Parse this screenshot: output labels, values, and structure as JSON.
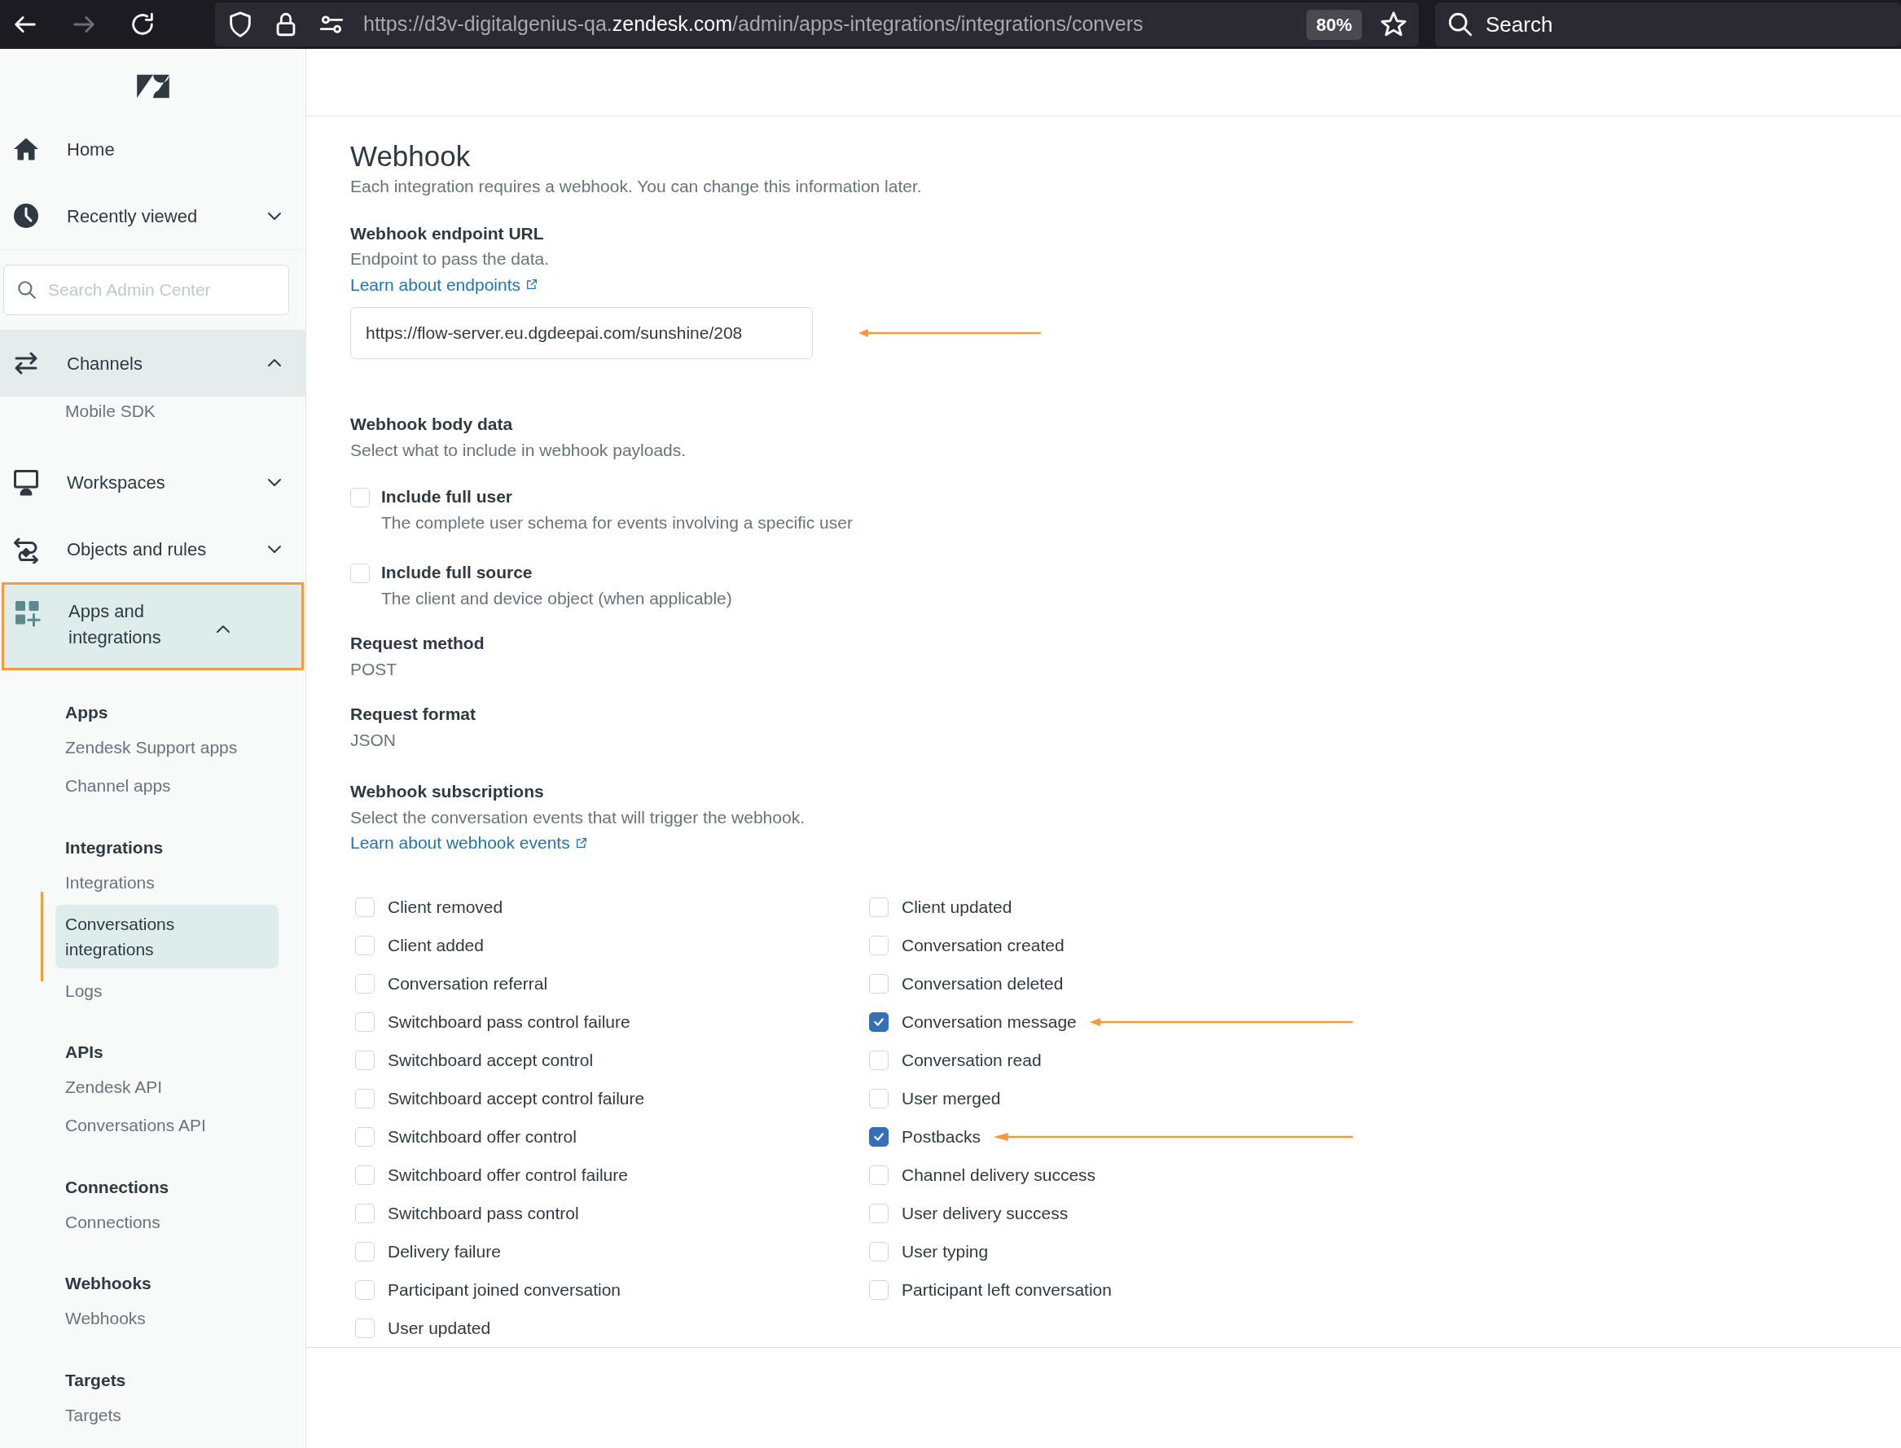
{
  "browser": {
    "url": "https://d3v-digitalgenius-qa.**zendesk.com**/admin/apps-integrations/integrations/convers",
    "zoom": "80%",
    "search_placeholder": "Search"
  },
  "sidebar": {
    "top_items": [
      {
        "label": "Home"
      },
      {
        "label": "Recently viewed",
        "expanded": false
      }
    ],
    "search": {
      "placeholder": "Search Admin Center"
    },
    "sections": [
      {
        "label": "Channels",
        "expanded": true,
        "hovered": true,
        "highlighted": false,
        "groups": [
          {
            "items": [
              {
                "label": "Mobile SDK",
                "selected": false
              }
            ]
          }
        ]
      },
      {
        "label": "Workspaces",
        "expanded": false,
        "hovered": false,
        "highlighted": false
      },
      {
        "label": "Objects and rules",
        "expanded": false,
        "hovered": false,
        "highlighted": false
      },
      {
        "label": "Apps and integrations",
        "expanded": true,
        "hovered": false,
        "highlighted": true,
        "groups": [
          {
            "heading": "Apps",
            "items": [
              {
                "label": "Zendesk Support apps",
                "selected": false
              },
              {
                "label": "Channel apps",
                "selected": false
              }
            ]
          },
          {
            "heading": "Integrations",
            "items": [
              {
                "label": "Integrations",
                "selected": false
              },
              {
                "label": "Conversations integrations",
                "selected": true
              },
              {
                "label": "Logs",
                "selected": false
              }
            ]
          },
          {
            "heading": "APIs",
            "items": [
              {
                "label": "Zendesk API",
                "selected": false
              },
              {
                "label": "Conversations API",
                "selected": false
              }
            ]
          },
          {
            "heading": "Connections",
            "items": [
              {
                "label": "Connections",
                "selected": false
              }
            ]
          },
          {
            "heading": "Webhooks",
            "items": [
              {
                "label": "Webhooks",
                "selected": false
              }
            ]
          },
          {
            "heading": "Targets",
            "items": [
              {
                "label": "Targets",
                "selected": false
              }
            ]
          }
        ]
      }
    ]
  },
  "main": {
    "title": "Webhook",
    "description": "Each integration requires a webhook. You can change this information later.",
    "endpoint": {
      "label": "Webhook endpoint URL",
      "hint": "Endpoint to pass the data.",
      "link": "Learn about endpoints",
      "value": "https://flow-server.eu.dgdeepai.com/sunshine/208",
      "annotated": true
    },
    "body_data": {
      "label": "Webhook body data",
      "hint": "Select what to include in webhook payloads.",
      "options": [
        {
          "label": "Include full user",
          "description": "The complete user schema for events involving a specific user",
          "checked": false
        },
        {
          "label": "Include full source",
          "description": "The client and device object (when applicable)",
          "checked": false
        }
      ]
    },
    "request_method": {
      "label": "Request method",
      "value": "POST"
    },
    "request_format": {
      "label": "Request format",
      "value": "JSON"
    },
    "subscriptions": {
      "label": "Webhook subscriptions",
      "hint": "Select the conversation events that will trigger the webhook.",
      "link": "Learn about webhook events",
      "columns": [
        [
          {
            "label": "Client removed",
            "checked": false,
            "annotated": false
          },
          {
            "label": "Client added",
            "checked": false,
            "annotated": false
          },
          {
            "label": "Conversation referral",
            "checked": false,
            "annotated": false
          },
          {
            "label": "Switchboard pass control failure",
            "checked": false,
            "annotated": false
          },
          {
            "label": "Switchboard accept control",
            "checked": false,
            "annotated": false
          },
          {
            "label": "Switchboard accept control failure",
            "checked": false,
            "annotated": false
          },
          {
            "label": "Switchboard offer control",
            "checked": false,
            "annotated": false
          },
          {
            "label": "Switchboard offer control failure",
            "checked": false,
            "annotated": false
          },
          {
            "label": "Switchboard pass control",
            "checked": false,
            "annotated": false
          },
          {
            "label": "Delivery failure",
            "checked": false,
            "annotated": false
          },
          {
            "label": "Participant joined conversation",
            "checked": false,
            "annotated": false
          },
          {
            "label": "User updated",
            "checked": false,
            "annotated": false
          }
        ],
        [
          {
            "label": "Client updated",
            "checked": false,
            "annotated": false
          },
          {
            "label": "Conversation created",
            "checked": false,
            "annotated": false
          },
          {
            "label": "Conversation deleted",
            "checked": false,
            "annotated": false
          },
          {
            "label": "Conversation message",
            "checked": true,
            "annotated": true
          },
          {
            "label": "Conversation read",
            "checked": false,
            "annotated": false
          },
          {
            "label": "User merged",
            "checked": false,
            "annotated": false
          },
          {
            "label": "Postbacks",
            "checked": true,
            "annotated": true
          },
          {
            "label": "Channel delivery success",
            "checked": false,
            "annotated": false
          },
          {
            "label": "User delivery success",
            "checked": false,
            "annotated": false
          },
          {
            "label": "User typing",
            "checked": false,
            "annotated": false
          },
          {
            "label": "Participant left conversation",
            "checked": false,
            "annotated": false
          }
        ]
      ]
    }
  }
}
